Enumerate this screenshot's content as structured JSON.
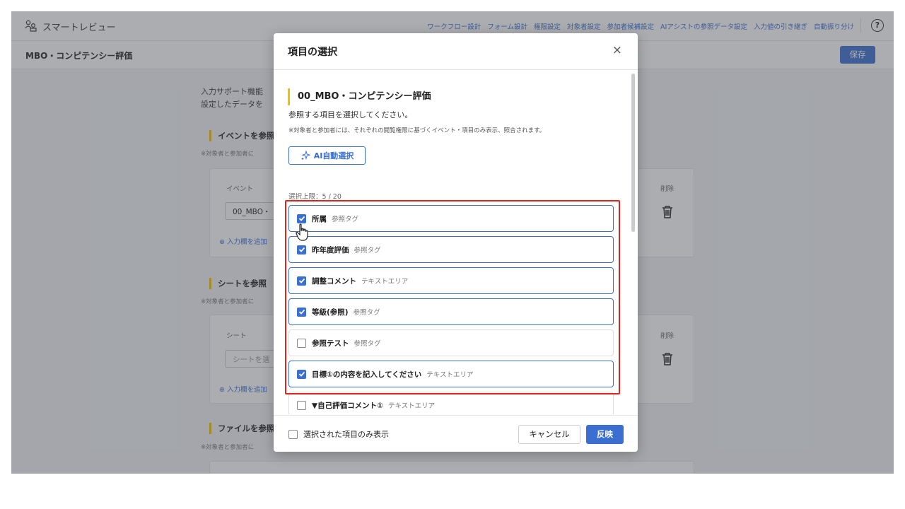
{
  "app": {
    "name": "スマートレビュー"
  },
  "nav": [
    "ワークフロー設計",
    "フォーム設計",
    "権限設定",
    "対象者設定",
    "参加者候補設定",
    "AIアシストの参照データ設定",
    "入力値の引き継ぎ",
    "自動振り分け"
  ],
  "page": {
    "title": "MBO・コンピテンシー評価",
    "save_label": "保存"
  },
  "background": {
    "intro_line1": "入力サポート機能",
    "intro_line2": "設定したデータを",
    "event_heading": "イベントを参照",
    "event_note": "※対象者と参加者に",
    "event_col": "イベント",
    "event_value": "00_MBO・",
    "delete_col": "削除",
    "add_field": "⊕ 入力欄を追加",
    "sheet_heading": "シートを参照",
    "sheet_note": "※対象者と参加者に",
    "sheet_col": "シート",
    "sheet_placeholder": "シートを選",
    "sheet_delete_col": "削除",
    "sheet_add_field": "⊕ 入力欄を追加",
    "file_heading": "ファイルを参照",
    "file_note": "※対象者と参加者に"
  },
  "modal": {
    "title": "項目の選択",
    "close_icon": "close-icon",
    "section_title": "00_MBO・コンピテンシー評価",
    "description": "参照する項目を選択してください。",
    "note": "※対象者と参加者には、それぞれの閲覧権限に基づくイベント・項目のみ表示、照合されます。",
    "ai_button": "AI自動選択",
    "limit": "選択上限：5 / 20",
    "items": [
      {
        "name": "所属",
        "type": "参照タグ",
        "checked": true
      },
      {
        "name": "昨年度評価",
        "type": "参照タグ",
        "checked": true
      },
      {
        "name": "調整コメント",
        "type": "テキストエリア",
        "checked": true
      },
      {
        "name": "等級(参照)",
        "type": "参照タグ",
        "checked": true
      },
      {
        "name": "参照テスト",
        "type": "参照タグ",
        "checked": false
      },
      {
        "name": "目標①の内容を記入してください",
        "type": "テキストエリア",
        "checked": true
      },
      {
        "name": "▼自己評価コメント①",
        "type": "テキストエリア",
        "checked": false
      }
    ],
    "footer": {
      "only_selected": "選択された項目のみ表示",
      "cancel": "キャンセル",
      "apply": "反映"
    }
  },
  "colors": {
    "accent": "#3a6fd1",
    "highlight": "#e0241b",
    "section_bar": "#f2c200"
  }
}
